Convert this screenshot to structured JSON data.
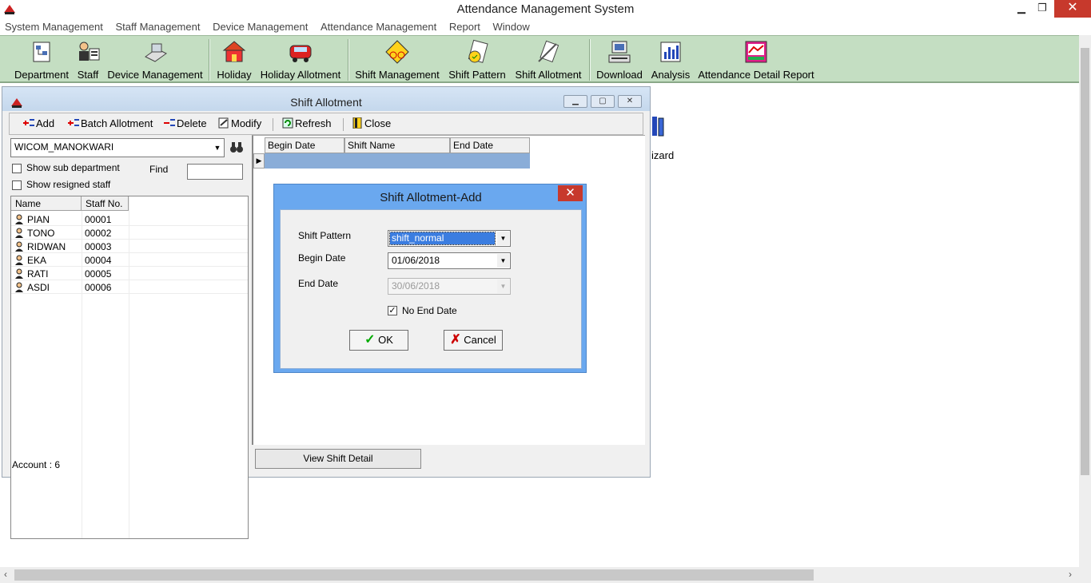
{
  "app": {
    "title": "Attendance Management System"
  },
  "window_controls": {
    "minimize": "▁",
    "restore": "❐",
    "close": "✕"
  },
  "menu": [
    "System Management",
    "Staff Management",
    "Device Management",
    "Attendance Management",
    "Report",
    "Window"
  ],
  "toolbar": [
    {
      "label": "Department",
      "icon": "department-icon"
    },
    {
      "label": "Staff",
      "icon": "staff-icon"
    },
    {
      "label": "Device Management",
      "icon": "device-icon"
    },
    {
      "label": "Holiday",
      "icon": "holiday-icon"
    },
    {
      "label": "Holiday Allotment",
      "icon": "holiday-allotment-icon"
    },
    {
      "label": "Shift Management",
      "icon": "shift-management-icon"
    },
    {
      "label": "Shift Pattern",
      "icon": "shift-pattern-icon"
    },
    {
      "label": "Shift Allotment",
      "icon": "shift-allotment-icon"
    },
    {
      "label": "Download",
      "icon": "download-icon"
    },
    {
      "label": "Analysis",
      "icon": "analysis-icon"
    },
    {
      "label": "Attendance Detail Report",
      "icon": "report-icon"
    }
  ],
  "desktop": {
    "wizard_label": "izard"
  },
  "shift_window": {
    "title": "Shift Allotment",
    "toolbar": {
      "add": "Add",
      "batch": "Batch Allotment",
      "delete": "Delete",
      "modify": "Modify",
      "refresh": "Refresh",
      "close": "Close"
    },
    "department": "WICOM_MANOKWARI",
    "show_sub": "Show sub department",
    "show_resigned": "Show resigned staff",
    "find_label": "Find",
    "find_value": "",
    "staff_columns": [
      "Name",
      "Staff No."
    ],
    "staff": [
      {
        "name": "PIAN",
        "no": "00001"
      },
      {
        "name": "TONO",
        "no": "00002"
      },
      {
        "name": "RIDWAN",
        "no": "00003"
      },
      {
        "name": "EKA",
        "no": "00004"
      },
      {
        "name": "RATI",
        "no": "00005"
      },
      {
        "name": "ASDI",
        "no": "00006"
      }
    ],
    "account": "Account : 6",
    "shift_columns": [
      "Begin Date",
      "Shift Name",
      "End Date"
    ],
    "view_detail": "View Shift Detail"
  },
  "dialog": {
    "title": "Shift Allotment-Add",
    "close": "✕",
    "shift_pattern_label": "Shift Pattern",
    "shift_pattern_value": "shift_normal",
    "begin_label": "Begin Date",
    "begin_value": "01/06/2018",
    "end_label": "End Date",
    "end_value": "30/06/2018",
    "no_end_label": "No End Date",
    "no_end_checked": true,
    "ok": "OK",
    "cancel": "Cancel"
  },
  "colors": {
    "toolbar_bg": "#c4dec2",
    "dialog_border": "#6aa8ef",
    "close_red": "#c7392c",
    "selection": "#8aadd8"
  }
}
